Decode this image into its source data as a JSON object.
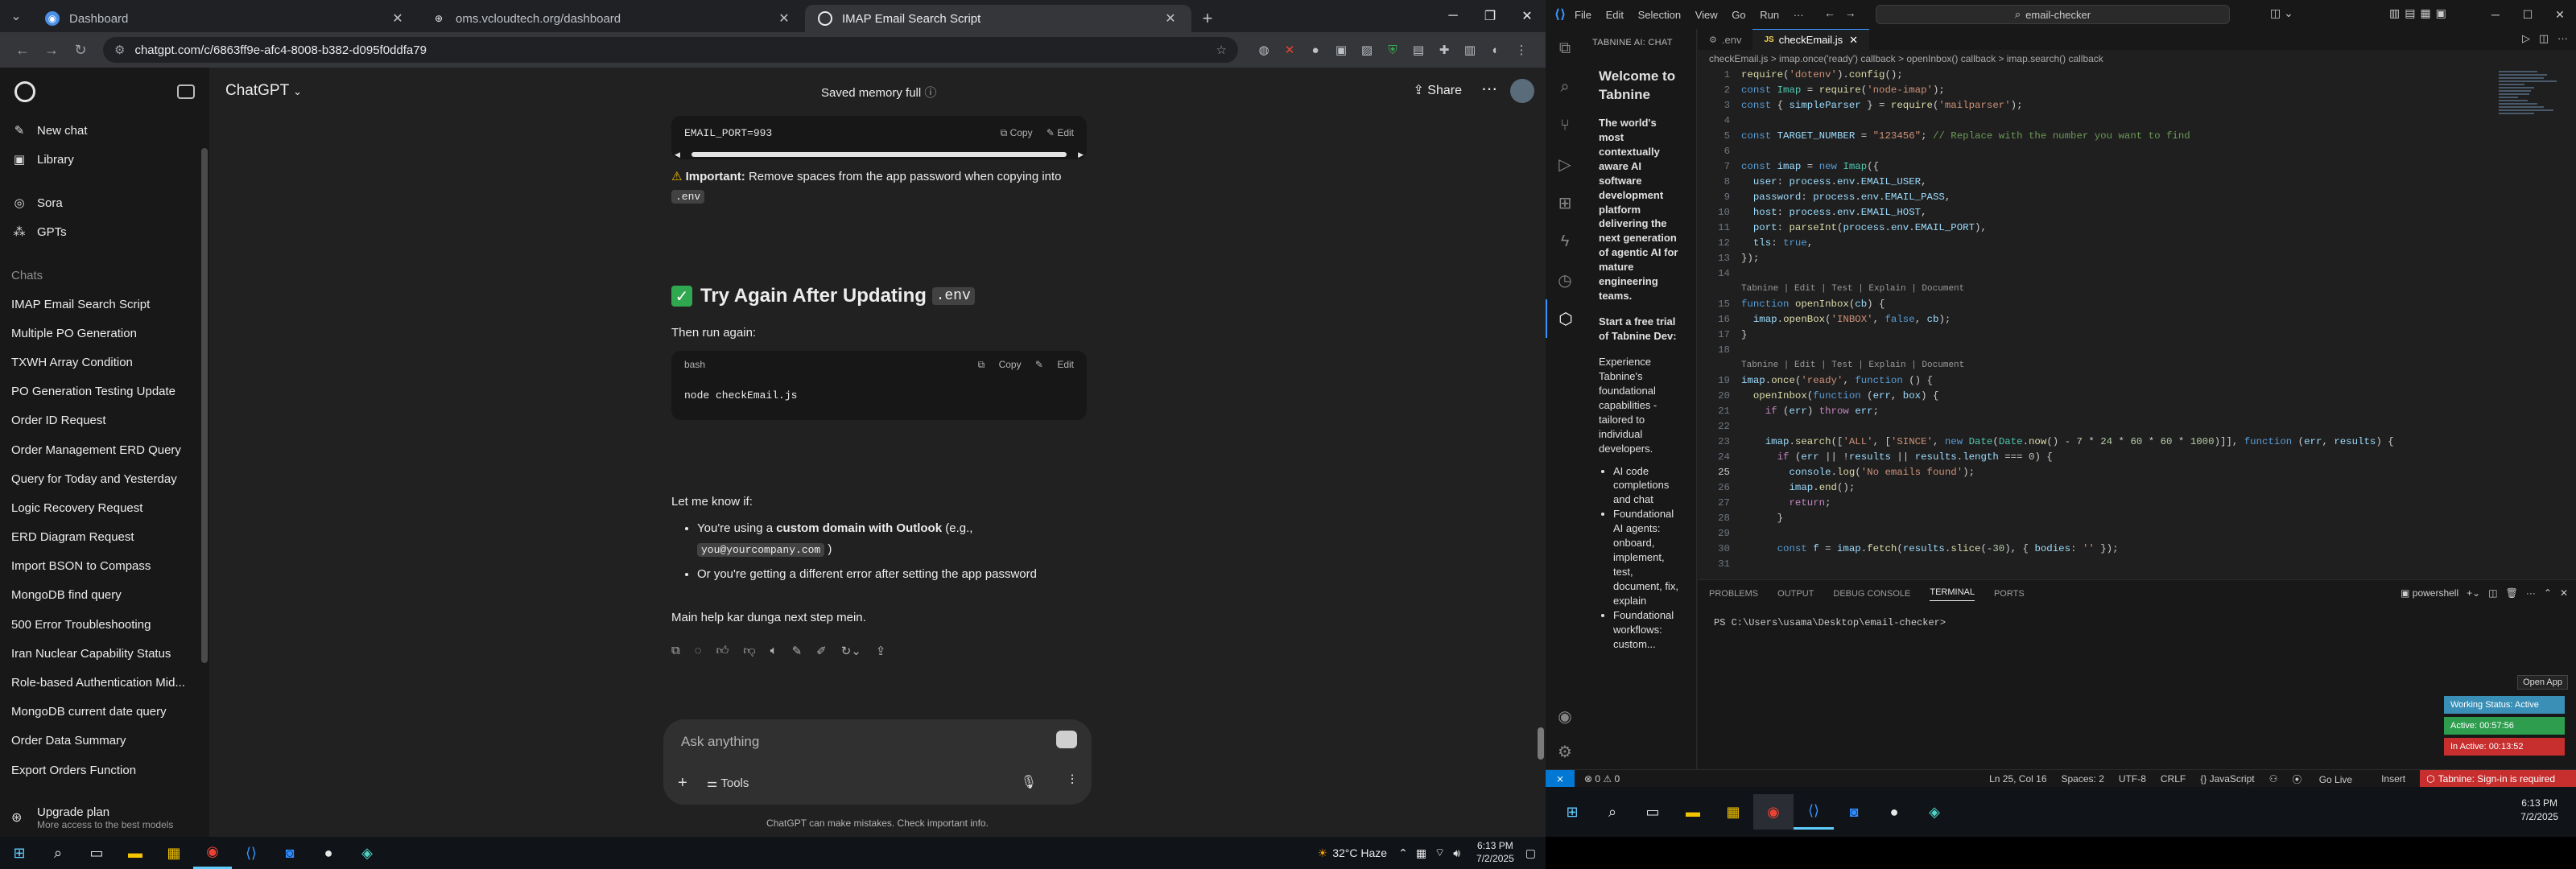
{
  "browser": {
    "tabs": [
      {
        "title": "Dashboard",
        "color": "#4a8fe7"
      },
      {
        "title": "oms.vcloudtech.org/dashboard",
        "color": "#e8eaed"
      },
      {
        "title": "IMAP Email Search Script",
        "color": "#e8eaed"
      }
    ],
    "url": "chatgpt.com/c/6863ff9e-afc4-8008-b382-d095f0ddfa79"
  },
  "sidebar": {
    "new_chat": "New chat",
    "library": "Library",
    "sora": "Sora",
    "gpts": "GPTs",
    "chats_heading": "Chats",
    "chats": [
      "IMAP Email Search Script",
      "Multiple PO Generation",
      "TXWH Array Condition",
      "PO Generation Testing Update",
      "Order ID Request",
      "Order Management ERD Query",
      "Query for Today and Yesterday",
      "Logic Recovery Request",
      "ERD Diagram Request",
      "Import BSON to Compass",
      "MongoDB find query",
      "500 Error Troubleshooting",
      "Iran Nuclear Capability Status",
      "Role-based Authentication Mid...",
      "MongoDB current date query",
      "Order Data Summary",
      "Export Orders Function"
    ],
    "upgrade_title": "Upgrade plan",
    "upgrade_sub": "More access to the best models"
  },
  "chat": {
    "model": "ChatGPT",
    "memory": "Saved memory full",
    "share": "Share",
    "code1_line": "EMAIL_PORT=993",
    "copy": "Copy",
    "edit": "Edit",
    "important_label": "Important:",
    "important_text": " Remove spaces from the app password when copying into ",
    "env": ".env",
    "section_title": "Try Again After Updating",
    "then_run": "Then run again:",
    "code2_lang": "bash",
    "code2_line": "node checkEmail.js",
    "let_me_know": "Let me know if:",
    "bullet1_pre": "You're using a ",
    "bullet1_bold": "custom domain with Outlook",
    "bullet1_post": " (e.g.,",
    "bullet1_code": "you@yourcompany.com",
    "bullet2": "Or you're getting a different error after setting the app password",
    "closing": "Main help kar dunga next step mein.",
    "composer_placeholder": "Ask anything",
    "tools": "Tools",
    "disclaimer": "ChatGPT can make mistakes. Check important info."
  },
  "taskbar_left": {
    "weather": "32°C  Haze",
    "time": "6:13 PM",
    "date": "7/2/2025"
  },
  "vscode": {
    "menu": [
      "File",
      "Edit",
      "Selection",
      "View",
      "Go",
      "Run"
    ],
    "search": "email-checker",
    "tabnine_title": "TABNINE AI: CHAT",
    "tabnine": {
      "welcome": "Welcome to Tabnine",
      "tagline": "The world's most contextually aware AI software development platform delivering the next generation of agentic AI for mature engineering teams.",
      "trial": "Start a free trial of Tabnine Dev:",
      "experience": "Experience Tabnine's foundational capabilities - tailored to individual developers.",
      "bullets": [
        "AI code completions and chat",
        "Foundational AI agents: onboard, implement, test, document, fix, explain",
        "Foundational workflows: custom..."
      ]
    },
    "tabs": [
      ".env",
      "checkEmail.js"
    ],
    "breadcrumb": "checkEmail.js  >  imap.once('ready') callback  >  openInbox() callback  >  imap.search() callback",
    "lens": "Tabnine | Edit | Test | Explain | Document",
    "panel_tabs": [
      "PROBLEMS",
      "OUTPUT",
      "DEBUG CONSOLE",
      "TERMINAL",
      "PORTS"
    ],
    "shell": "powershell",
    "terminal_line": "PS C:\\Users\\usama\\Desktop\\email-checker>",
    "open_app": "Open App",
    "working_status": "Working Status: Active",
    "active_time": "Active: 00:57:56",
    "inactive_time": "In Active: 00:13:52",
    "status": {
      "errors": "⊗ 0 ⚠ 0",
      "position": "Ln 25, Col 16",
      "spaces": "Spaces: 2",
      "encoding": "UTF-8",
      "eol": "CRLF",
      "language": "{} JavaScript",
      "golive": "Go Live",
      "insert": "Insert",
      "tabnine": "Tabnine: Sign-in is required"
    },
    "clock_time": "6:13 PM",
    "clock_date": "7/2/2025"
  }
}
